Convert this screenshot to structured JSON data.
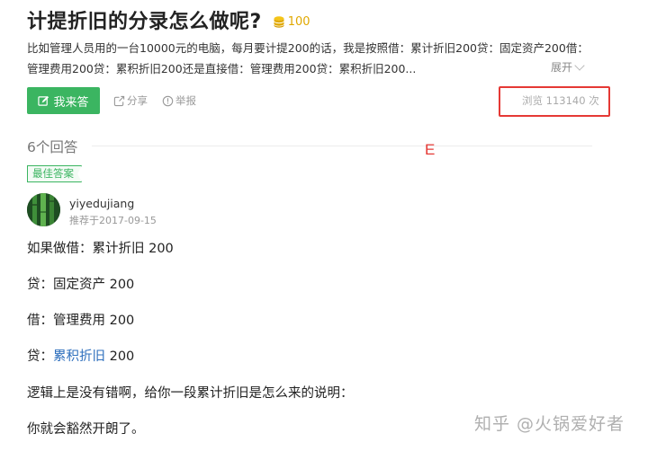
{
  "question": {
    "title": "计提折旧的分录怎么做呢?",
    "reward": "100",
    "description": "比如管理人员用的一台10000元的电脑，每月要计提200的话，我是按照借：累计折旧200贷：固定资产200借：管理费用200贷：累积折旧200还是直接借：管理费用200贷：累积折旧200...",
    "expand_label": "展开"
  },
  "actions": {
    "answer_label": "我来答",
    "share_label": "分享",
    "report_label": "举报",
    "views_label": "浏览 113140 次"
  },
  "answers": {
    "count_label": "6个回答",
    "annotation_mark": "E",
    "best": {
      "badge": "最佳答案",
      "username": "yiyedujiang",
      "date": "推荐于2017-09-15",
      "lines": [
        "如果做借：累计折旧 200",
        "贷：固定资产 200",
        "借：管理费用 200",
        "贷：",
        "累积折旧",
        " 200",
        "逻辑上是没有错啊，给你一段累计折旧是怎么来的说明：",
        "你就会豁然开朗了。"
      ]
    }
  },
  "watermark": "知乎 @火锅爱好者",
  "colors": {
    "accent": "#3bb561",
    "coin": "#e0a800",
    "highlight_box": "#e53935",
    "link": "#2e6fbd"
  },
  "icons": {
    "coin": "coin-stack-icon",
    "pen": "pen-square-icon",
    "share": "share-icon",
    "report": "info-circle-icon",
    "expand": "chevron-down-icon"
  }
}
